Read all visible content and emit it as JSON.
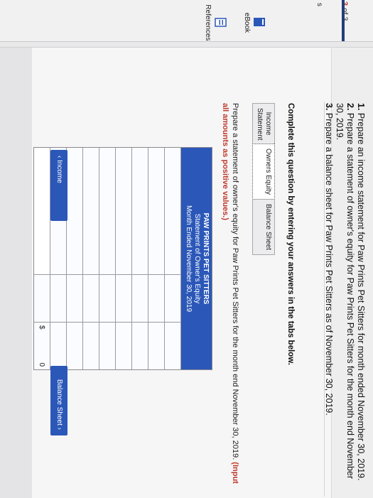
{
  "rail": {
    "page_number": "3",
    "page_suffix": " of 3",
    "edge_letter": "s"
  },
  "tools": {
    "ebook": "eBook",
    "references": "References"
  },
  "instructions": [
    {
      "num": "1.",
      "text": " Prepare an income statement for Paw Prints Pet Sitters for month ended November 30, 2019."
    },
    {
      "num": "2.",
      "text": " Prepare a statement of owner's equity for Paw Prints Pet Sitters for the month end November 30, 2019."
    },
    {
      "num": "3.",
      "text": " Prepare a balance sheet for Paw Prints Pet Sitters as of November 30, 2019."
    }
  ],
  "complete_prompt": "Complete this question by entering your answers in the tabs below.",
  "tabs": [
    {
      "label": "Income Statement",
      "active": false
    },
    {
      "label": "Owners Equity",
      "active": true
    },
    {
      "label": "Balance Sheet",
      "active": false
    }
  ],
  "prepare_text": "Prepare a statement of owner's equity for Paw Prints Pet Sitters for the month end November 30, 2019.",
  "prepare_hint": " (Input all amounts as positive values.)",
  "table": {
    "title": "PAW PRINTS PET SITTERS",
    "subtitle": "Statement of Owner's Equity",
    "period": "Month Ended November 30, 2019",
    "currency_symbol": "$",
    "total_value": "0"
  },
  "nav": {
    "prev_label": "Income Statement",
    "next_label": "Balance Sheet",
    "prev_arrow": "‹",
    "next_arrow": "›"
  },
  "colors": {
    "accent": "#2b57b8",
    "hint": "#c0392b"
  }
}
